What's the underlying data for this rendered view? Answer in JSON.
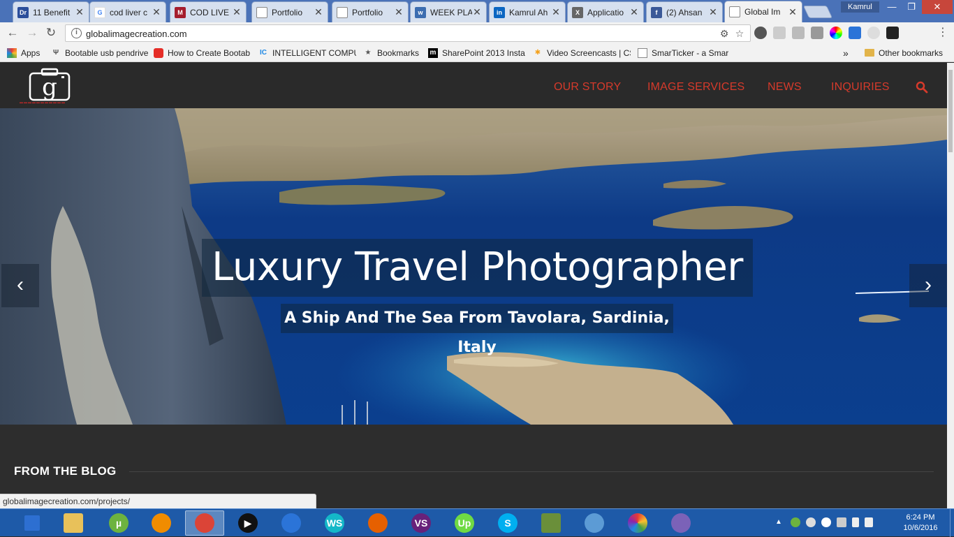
{
  "browser": {
    "tabs": [
      {
        "title": "11 Benefit",
        "favicon": "DrAxe",
        "color": "#2b4e9b"
      },
      {
        "title": "cod liver c",
        "favicon": "G",
        "color": "#ffffff"
      },
      {
        "title": "COD LIVE",
        "favicon": "M",
        "color": "#a51d2d"
      },
      {
        "title": "Portfolio",
        "favicon": "doc",
        "color": "#ffffff"
      },
      {
        "title": "Portfolio",
        "favicon": "doc",
        "color": "#ffffff"
      },
      {
        "title": "WEEK PLA",
        "favicon": "w",
        "color": "#3c6db0"
      },
      {
        "title": "Kamrul Ah",
        "favicon": "in",
        "color": "#0b66c2"
      },
      {
        "title": "Applicatio",
        "favicon": "X",
        "color": "#666666"
      },
      {
        "title": "(2) Ahsan",
        "favicon": "f",
        "color": "#3b5998"
      },
      {
        "title": "Global Im",
        "favicon": "doc",
        "color": "#ffffff"
      }
    ],
    "profile_name": "Kamrul",
    "url": "globalimagecreation.com",
    "bookmarks": [
      {
        "label": "Apps",
        "icon": "apps-grid-icon"
      },
      {
        "label": "Bootable usb pendrive",
        "icon": "usb-icon"
      },
      {
        "label": "How to Create Bootab",
        "icon": "youtube-icon"
      },
      {
        "label": "INTELLIGENT COMPUT",
        "icon": "ic-icon"
      },
      {
        "label": "Bookmarks",
        "icon": "star-icon"
      },
      {
        "label": "SharePoint 2013 Insta",
        "icon": "m-icon"
      },
      {
        "label": "Video Screencasts | CS",
        "icon": "asterisk-icon"
      },
      {
        "label": "SmarTicker - a Smart",
        "icon": "page-icon"
      }
    ],
    "bookmarks_overflow": "»",
    "other_bookmarks": "Other bookmarks",
    "status_url": "globalimagecreation.com/projects/"
  },
  "site": {
    "nav": [
      "OUR STORY",
      "IMAGE SERVICES",
      "NEWS",
      "INQUIRIES"
    ],
    "hero": {
      "title": "Luxury Travel Photographer",
      "subtitle": "A Ship And The Sea From Tavolara, Sardinia, Italy"
    },
    "blog_heading": "FROM THE BLOG",
    "accent_color": "#d63a2b"
  },
  "taskbar": {
    "apps": [
      "start",
      "file-explorer",
      "utorrent",
      "vlc",
      "chrome",
      "media-player",
      "google-drive",
      "webstorm",
      "firefox",
      "visual-studio",
      "upwork",
      "skype",
      "notepad",
      "paint",
      "picasa",
      "app"
    ],
    "time": "6:24 PM",
    "date": "10/6/2016"
  }
}
